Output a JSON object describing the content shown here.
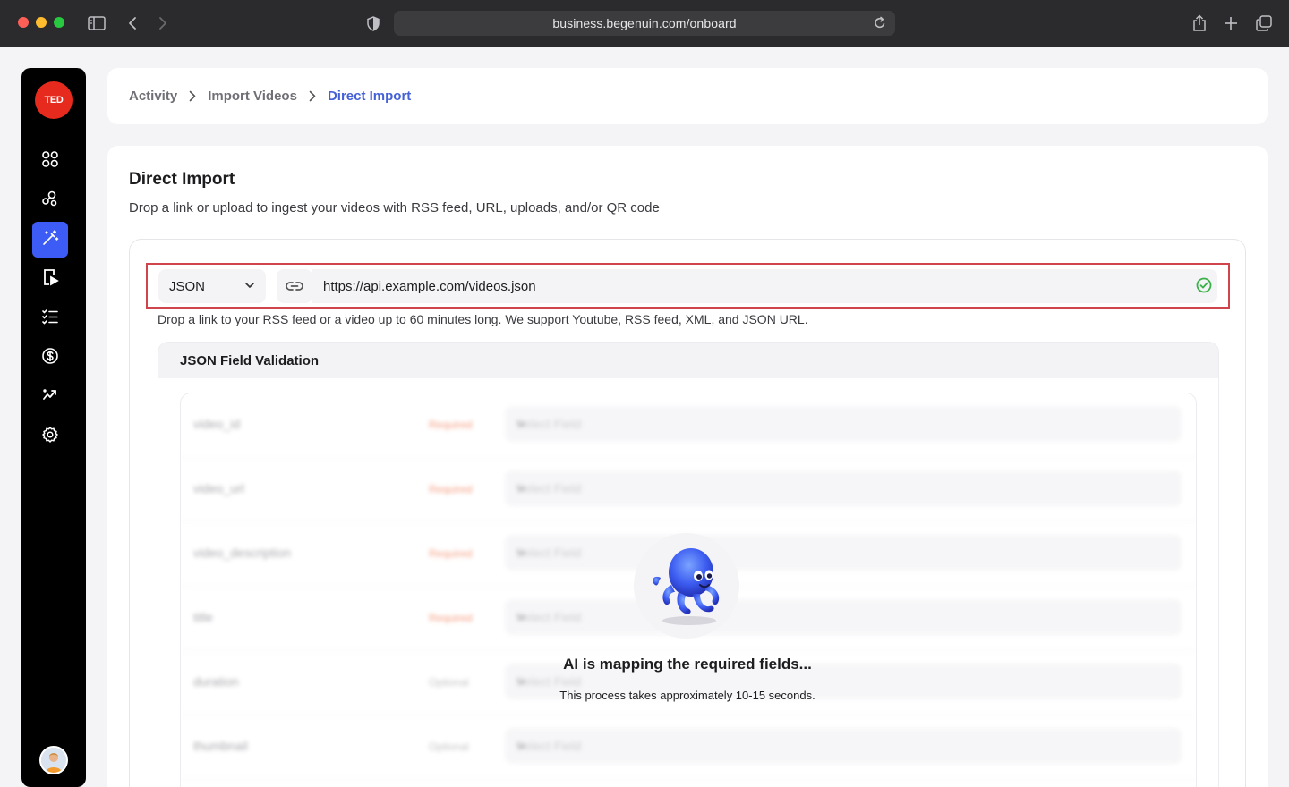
{
  "browser": {
    "url": "business.begenuin.com/onboard"
  },
  "sidebar": {
    "logo_text": "TED",
    "items": [
      {
        "name": "dashboard",
        "icon": "grid-icon",
        "active": false
      },
      {
        "name": "community",
        "icon": "people-icon",
        "active": false
      },
      {
        "name": "create",
        "icon": "magic-wand-icon",
        "active": true
      },
      {
        "name": "videos",
        "icon": "video-doc-icon",
        "active": false
      },
      {
        "name": "tasks",
        "icon": "checklist-icon",
        "active": false
      },
      {
        "name": "monetization",
        "icon": "dollar-icon",
        "active": false
      },
      {
        "name": "analytics",
        "icon": "trend-icon",
        "active": false
      },
      {
        "name": "settings",
        "icon": "gear-icon",
        "active": false
      }
    ],
    "accent": "#3d5cf5"
  },
  "breadcrumb": {
    "items": [
      "Activity",
      "Import Videos",
      "Direct Import"
    ]
  },
  "main": {
    "title": "Direct Import",
    "subtitle": "Drop a link or upload to ingest your videos with RSS feed, URL, uploads, and/or QR code",
    "source_type": "JSON",
    "url_value": "https://api.example.com/videos.json",
    "hint": "Drop a link to your RSS feed or a video up to 60 minutes long. We support Youtube, RSS feed, XML, and JSON URL.",
    "validation_title": "JSON Field Validation",
    "fields": [
      {
        "name": "video_id",
        "requirement": "Required",
        "placeholder": "Select Field"
      },
      {
        "name": "video_url",
        "requirement": "Required",
        "placeholder": "Select Field"
      },
      {
        "name": "video_description",
        "requirement": "Required",
        "placeholder": "Select Field"
      },
      {
        "name": "title",
        "requirement": "Required",
        "placeholder": "Select Field"
      },
      {
        "name": "duration",
        "requirement": "Optional",
        "placeholder": "Select Field"
      },
      {
        "name": "thumbnail",
        "requirement": "Optional",
        "placeholder": "Select Field"
      }
    ],
    "loading_title": "AI is mapping the required fields...",
    "loading_subtitle": "This process takes approximately 10-15 seconds."
  }
}
